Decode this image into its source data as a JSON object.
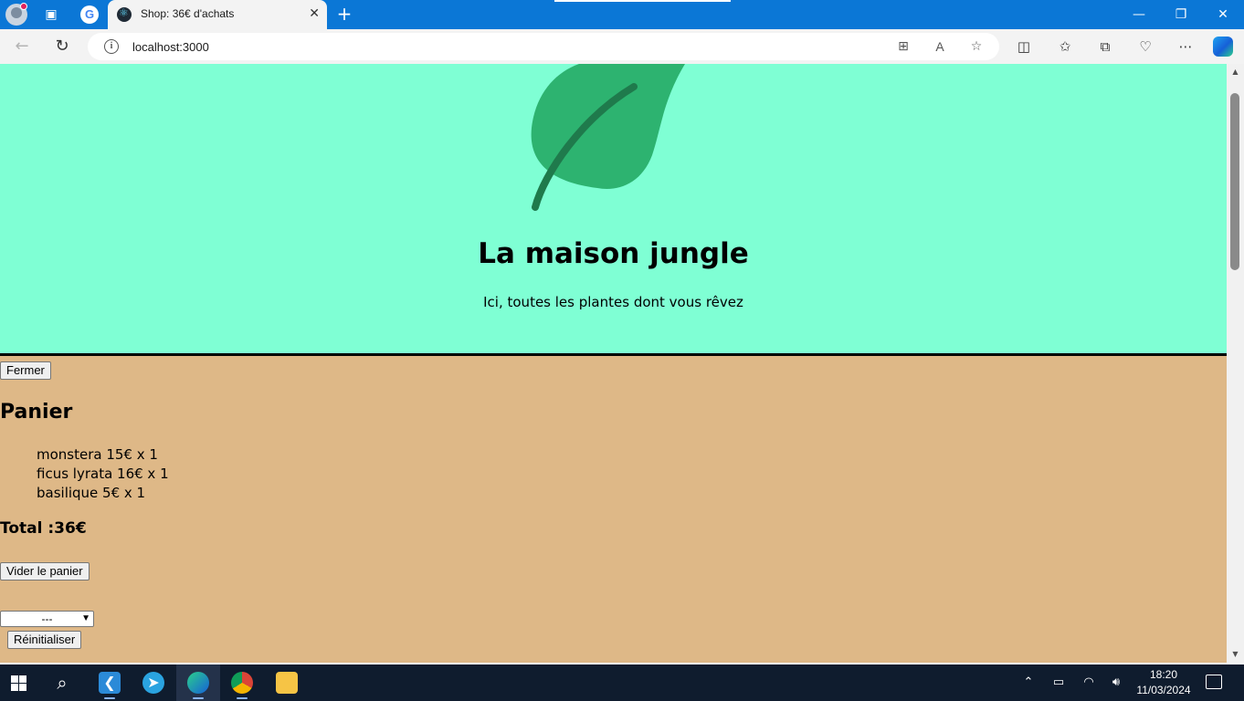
{
  "browser": {
    "tab_title": "Shop: 36€ d'achats",
    "url": "localhost:3000",
    "close_tab_glyph": "✕",
    "new_tab_glyph": "+",
    "window_controls": {
      "minimize": "—",
      "restore": "❐",
      "close": "✕"
    }
  },
  "page": {
    "banner_color": "#7fffd4",
    "background_color": "#deb887",
    "title": "La maison jungle",
    "subtitle": "Ici, toutes les plantes dont vous rêvez",
    "close_button": "Fermer",
    "cart": {
      "title": "Panier",
      "items": [
        "monstera 15€ x 1",
        "ficus lyrata 16€ x 1",
        "basilique 5€ x 1"
      ],
      "total": "Total :36€",
      "empty_button": "Vider le panier"
    },
    "category_select": {
      "selected": "---"
    },
    "reset_button": "Réinitialiser"
  },
  "taskbar": {
    "time": "18:20",
    "date": "11/03/2024"
  }
}
